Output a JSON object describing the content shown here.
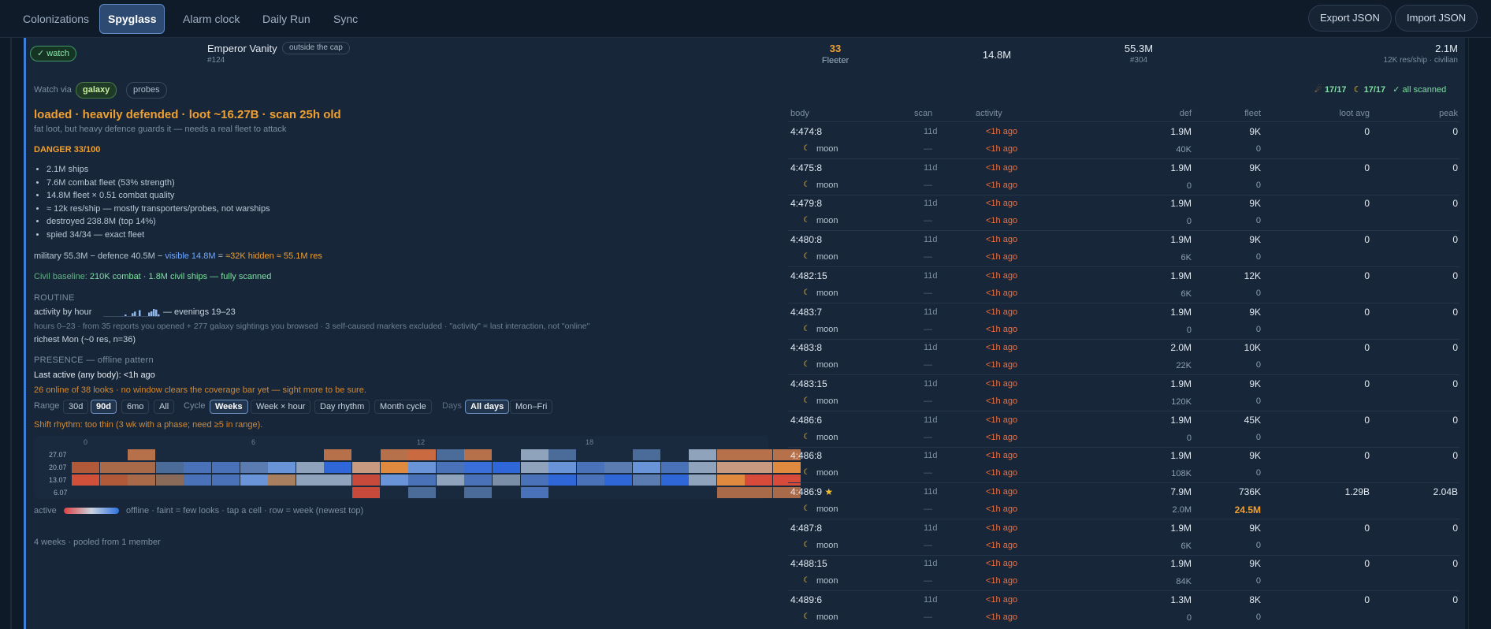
{
  "nav": {
    "tabs": [
      "Colonizations",
      "Spyglass",
      "Alarm clock",
      "Daily Run",
      "Sync"
    ],
    "export_label": "Export JSON",
    "import_label": "Import JSON"
  },
  "summary": {
    "watch_label": "✓ watch",
    "player_name": "Emperor Vanity",
    "cap_badge": "outside the cap",
    "rank": "#124",
    "level": "33",
    "class": "Fleeter",
    "fleet": "14.8M",
    "points": "55.3M",
    "points_rank": "#304",
    "ships": "2.1M",
    "ships_note": "12K res/ship · civilian"
  },
  "watch_via": {
    "label": "Watch via",
    "options": [
      "galaxy",
      "probes"
    ]
  },
  "scan_status": {
    "planets": "17/17",
    "moons": "17/17",
    "all": "✓ all scanned"
  },
  "verdict": {
    "headline": "loaded · heavily defended · loot ~16.27B · scan 25h old",
    "sub": "fat loot, but heavy defence guards it — needs a real fleet to attack",
    "danger": "DANGER 33/100",
    "bullets": [
      "2.1M ships",
      "7.6M combat fleet (53% strength)",
      "14.8M fleet × 0.51 combat quality",
      "≈ 12k res/ship — mostly transporters/probes, not warships",
      "destroyed 238.8M (top 14%)",
      "spied 34/34 — exact fleet"
    ],
    "hidden_prefix": "military 55.3M − defence 40.5M − ",
    "hidden_visible": "visible 14.8M",
    "hidden_eq": " = ",
    "hidden_result": "≈32K hidden ≈ 55.1M res",
    "civil_label": "Civil baseline: ",
    "civil_value": "210K combat · 1.8M civil ships — fully scanned"
  },
  "routine": {
    "title": "ROUTINE",
    "activity_label": "activity by hour",
    "activity_note": "— evenings 19–23",
    "hours": [
      0,
      0,
      0,
      0,
      0,
      0,
      0,
      0,
      0,
      0.12,
      0,
      0,
      0.25,
      0.38,
      0,
      0.5,
      0,
      0,
      0,
      0.3,
      0.4,
      0.6,
      0.55,
      0.15
    ],
    "sources": "hours 0–23 · from 35 reports you opened + 277 galaxy sightings you browsed · 3 self-caused markers excluded · \"activity\" = last interaction, not \"online\"",
    "richest": "richest Mon (~0 res, n=36)"
  },
  "presence": {
    "title": "PRESENCE — offline pattern",
    "last_active": "Last active (any body): <1h ago",
    "coverage": "26 online of 38 looks · no window clears the coverage bar yet — sight more to be sure.",
    "range_label": "Range",
    "ranges": [
      "30d",
      "90d",
      "6mo",
      "All"
    ],
    "cycle_label": "Cycle",
    "cycles": [
      "Weeks",
      "Week × hour",
      "Day rhythm",
      "Month cycle"
    ],
    "days_label": "Days",
    "days": [
      "All days",
      "Mon–Fri"
    ],
    "shift_rhythm": "Shift rhythm: too thin (3 wk with a phase; need ≥5 in range).",
    "hour_ticks": [
      "0",
      "6",
      "12",
      "18"
    ],
    "weeks": [
      "27.07",
      "20.07",
      "13.07",
      "6.07"
    ],
    "grid": [
      [
        "",
        "",
        "b6704a",
        "",
        "",
        "",
        "",
        "",
        "",
        "b6704a",
        "",
        "b6704a",
        "c96a40",
        "4b6c99",
        "b6704a",
        "",
        "8fa3bd",
        "4b6c99",
        "",
        "",
        "4b6c99",
        "",
        "8fa3bd",
        "b6704a",
        "b6704a",
        "b6704a"
      ],
      [
        "b05a3a",
        "a86a48",
        "a86a48",
        "4b6c99",
        "4a72b8",
        "4a72b8",
        "5b7cb0",
        "6a94d8",
        "8fa3bd",
        "2f67d8",
        "c89b80",
        "e08a40",
        "6a94d8",
        "4a72b8",
        "3a6ed8",
        "2f67d8",
        "8fa3bd",
        "6a94d8",
        "4a72b8",
        "5b7cb0",
        "6a94d8",
        "4a72b8",
        "8fa3bd",
        "c89b80",
        "c89b80",
        "e08a40"
      ],
      [
        "d0503a",
        "b05a3a",
        "a86a48",
        "8a6a58",
        "4a72b8",
        "4a72b8",
        "6a94d8",
        "a88060",
        "8fa3bd",
        "8fa3bd",
        "c84a3a",
        "6a94d8",
        "4a72b8",
        "8fa3bd",
        "4a72b8",
        "7a8ea8",
        "4a72b8",
        "2f67d8",
        "4a72b8",
        "2f67d8",
        "5b7cb0",
        "2f67d8",
        "8fa3bd",
        "e08a40",
        "d84a3a",
        "d84a3a"
      ],
      [
        "",
        "",
        "",
        "",
        "",
        "",
        "",
        "",
        "",
        "",
        "c84a3a",
        "",
        "4b6c99",
        "",
        "4b6c99",
        "",
        "4a72b8",
        "",
        "",
        "",
        "",
        "",
        "",
        "a86a48",
        "a86a48",
        "a86a48"
      ]
    ],
    "legend_active": "active",
    "legend_note": "offline · faint = few looks · tap a cell · row = week (newest top)",
    "footer": "4 weeks · pooled from 1 member"
  },
  "table": {
    "columns": [
      "body",
      "scan",
      "activity",
      "def",
      "fleet",
      "loot avg",
      "peak"
    ],
    "rows": [
      {
        "coord": "4:474:8",
        "scan": "11d",
        "activity": "<1h ago",
        "def": "1.9M",
        "fleet": "9K",
        "loot": "0",
        "peak": "0",
        "moon_label": "moon",
        "moon_scan": "—",
        "moon_activity": "<1h ago",
        "moon_def": "40K",
        "moon_fleet": "0",
        "star": false
      },
      {
        "coord": "4:475:8",
        "scan": "11d",
        "activity": "<1h ago",
        "def": "1.9M",
        "fleet": "9K",
        "loot": "0",
        "peak": "0",
        "moon_label": "moon",
        "moon_scan": "—",
        "moon_activity": "<1h ago",
        "moon_def": "0",
        "moon_fleet": "0",
        "star": false
      },
      {
        "coord": "4:479:8",
        "scan": "11d",
        "activity": "<1h ago",
        "def": "1.9M",
        "fleet": "9K",
        "loot": "0",
        "peak": "0",
        "moon_label": "moon",
        "moon_scan": "—",
        "moon_activity": "<1h ago",
        "moon_def": "0",
        "moon_fleet": "0",
        "star": false
      },
      {
        "coord": "4:480:8",
        "scan": "11d",
        "activity": "<1h ago",
        "def": "1.9M",
        "fleet": "9K",
        "loot": "0",
        "peak": "0",
        "moon_label": "moon",
        "moon_scan": "—",
        "moon_activity": "<1h ago",
        "moon_def": "6K",
        "moon_fleet": "0",
        "star": false
      },
      {
        "coord": "4:482:15",
        "scan": "11d",
        "activity": "<1h ago",
        "def": "1.9M",
        "fleet": "12K",
        "loot": "0",
        "peak": "0",
        "moon_label": "moon",
        "moon_scan": "—",
        "moon_activity": "<1h ago",
        "moon_def": "6K",
        "moon_fleet": "0",
        "star": false
      },
      {
        "coord": "4:483:7",
        "scan": "11d",
        "activity": "<1h ago",
        "def": "1.9M",
        "fleet": "9K",
        "loot": "0",
        "peak": "0",
        "moon_label": "moon",
        "moon_scan": "—",
        "moon_activity": "<1h ago",
        "moon_def": "0",
        "moon_fleet": "0",
        "star": false
      },
      {
        "coord": "4:483:8",
        "scan": "11d",
        "activity": "<1h ago",
        "def": "2.0M",
        "fleet": "10K",
        "loot": "0",
        "peak": "0",
        "moon_label": "moon",
        "moon_scan": "—",
        "moon_activity": "<1h ago",
        "moon_def": "22K",
        "moon_fleet": "0",
        "star": false
      },
      {
        "coord": "4:483:15",
        "scan": "11d",
        "activity": "<1h ago",
        "def": "1.9M",
        "fleet": "9K",
        "loot": "0",
        "peak": "0",
        "moon_label": "moon",
        "moon_scan": "—",
        "moon_activity": "<1h ago",
        "moon_def": "120K",
        "moon_fleet": "0",
        "star": false
      },
      {
        "coord": "4:486:6",
        "scan": "11d",
        "activity": "<1h ago",
        "def": "1.9M",
        "fleet": "45K",
        "loot": "0",
        "peak": "0",
        "moon_label": "moon",
        "moon_scan": "—",
        "moon_activity": "<1h ago",
        "moon_def": "0",
        "moon_fleet": "0",
        "star": false
      },
      {
        "coord": "4:486:8",
        "scan": "11d",
        "activity": "<1h ago",
        "def": "1.9M",
        "fleet": "9K",
        "loot": "0",
        "peak": "0",
        "moon_label": "moon",
        "moon_scan": "—",
        "moon_activity": "<1h ago",
        "moon_def": "108K",
        "moon_fleet": "0",
        "star": false
      },
      {
        "coord": "4:486:9",
        "scan": "11d",
        "activity": "<1h ago",
        "def": "7.9M",
        "fleet": "736K",
        "loot": "1.29B",
        "peak": "2.04B",
        "moon_label": "moon",
        "moon_scan": "—",
        "moon_activity": "<1h ago",
        "moon_def": "2.0M",
        "moon_fleet": "24.5M",
        "star": true
      },
      {
        "coord": "4:487:8",
        "scan": "11d",
        "activity": "<1h ago",
        "def": "1.9M",
        "fleet": "9K",
        "loot": "0",
        "peak": "0",
        "moon_label": "moon",
        "moon_scan": "—",
        "moon_activity": "<1h ago",
        "moon_def": "6K",
        "moon_fleet": "0",
        "star": false
      },
      {
        "coord": "4:488:15",
        "scan": "11d",
        "activity": "<1h ago",
        "def": "1.9M",
        "fleet": "9K",
        "loot": "0",
        "peak": "0",
        "moon_label": "moon",
        "moon_scan": "—",
        "moon_activity": "<1h ago",
        "moon_def": "84K",
        "moon_fleet": "0",
        "star": false
      },
      {
        "coord": "4:489:6",
        "scan": "11d",
        "activity": "<1h ago",
        "def": "1.3M",
        "fleet": "8K",
        "loot": "0",
        "peak": "0",
        "moon_label": "moon",
        "moon_scan": "—",
        "moon_activity": "<1h ago",
        "moon_def": "0",
        "moon_fleet": "0",
        "star": false
      }
    ]
  }
}
